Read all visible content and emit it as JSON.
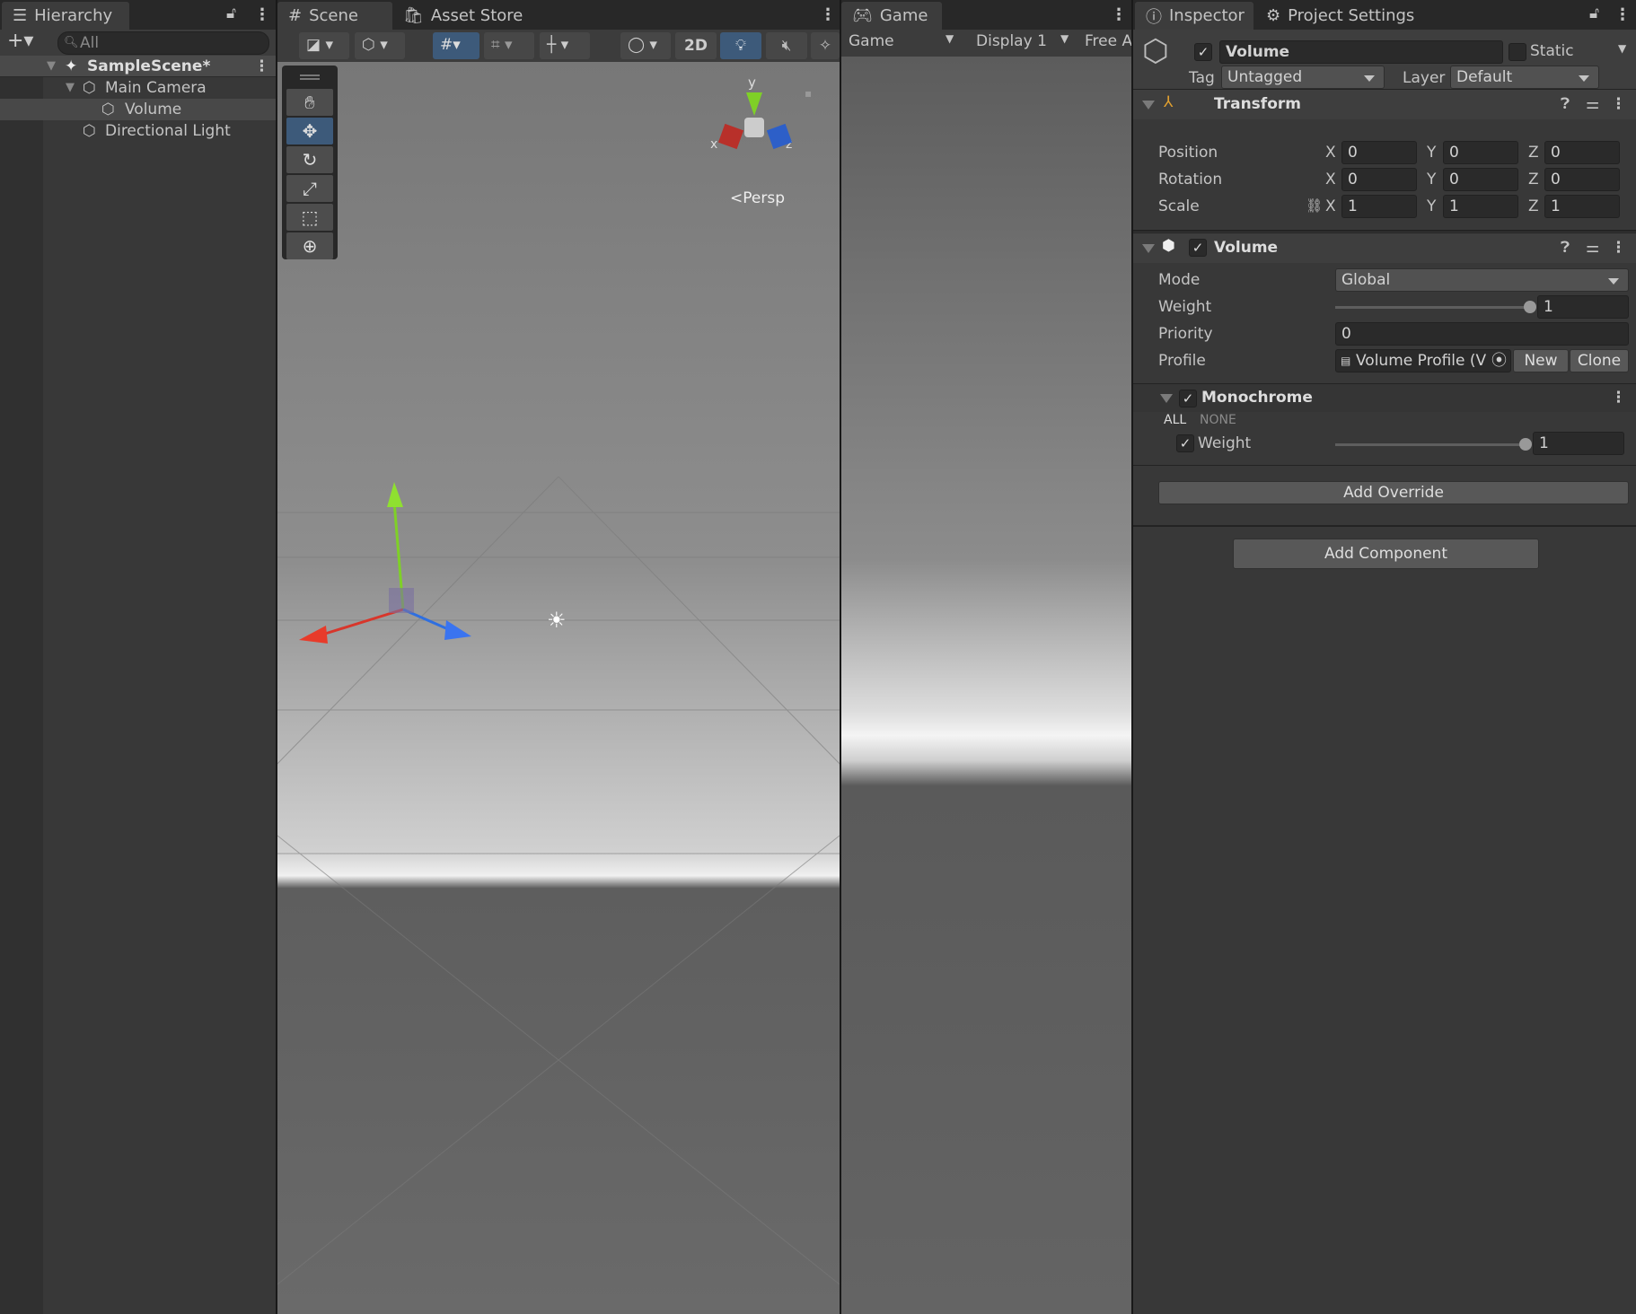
{
  "hierarchy": {
    "tab": "Hierarchy",
    "search_placeholder": "All",
    "items": [
      {
        "label": "SampleScene*",
        "depth": 0,
        "type": "scene"
      },
      {
        "label": "Main Camera",
        "depth": 1,
        "type": "gameobject"
      },
      {
        "label": "Volume",
        "depth": 2,
        "type": "gameobject",
        "selected": true
      },
      {
        "label": "Directional Light",
        "depth": 1,
        "type": "gameobject"
      }
    ]
  },
  "scene": {
    "tabs": [
      "Scene",
      "Asset Store"
    ],
    "toolbar": {
      "mode_2d": "2D"
    },
    "gizmo": {
      "x": "x",
      "y": "y",
      "z": "z",
      "projection": "Persp"
    },
    "tools": [
      "hand-tool",
      "move-tool",
      "rotate-tool",
      "scale-tool",
      "rect-tool",
      "transform-tool"
    ],
    "active_tool": "move-tool"
  },
  "game": {
    "tab": "Game",
    "view_select": "Game",
    "display": "Display 1",
    "aspect": "Free A"
  },
  "inspector": {
    "tabs": [
      "Inspector",
      "Project Settings"
    ],
    "object": {
      "name": "Volume",
      "active": true,
      "static_label": "Static",
      "static": false,
      "tag_label": "Tag",
      "tag": "Untagged",
      "layer_label": "Layer",
      "layer": "Default"
    },
    "transform": {
      "title": "Transform",
      "rows": [
        {
          "label": "Position",
          "x": "0",
          "y": "0",
          "z": "0"
        },
        {
          "label": "Rotation",
          "x": "0",
          "y": "0",
          "z": "0"
        },
        {
          "label": "Scale",
          "x": "1",
          "y": "1",
          "z": "1"
        }
      ],
      "axis": [
        "X",
        "Y",
        "Z"
      ]
    },
    "volume": {
      "title": "Volume",
      "enabled": true,
      "mode_label": "Mode",
      "mode": "Global",
      "weight_label": "Weight",
      "weight": "1",
      "priority_label": "Priority",
      "priority": "0",
      "profile_label": "Profile",
      "profile": "Volume Profile (V",
      "new_label": "New",
      "clone_label": "Clone"
    },
    "monochrome": {
      "title": "Monochrome",
      "enabled": true,
      "all": "ALL",
      "none": "NONE",
      "weight_label": "Weight",
      "weight": "1"
    },
    "add_override": "Add Override",
    "add_component": "Add Component"
  },
  "colors": {
    "accent": "#3d5a7a",
    "panel": "#383838",
    "x_axis": "#d8362b",
    "y_axis": "#7fd027",
    "z_axis": "#2f6fe0"
  }
}
